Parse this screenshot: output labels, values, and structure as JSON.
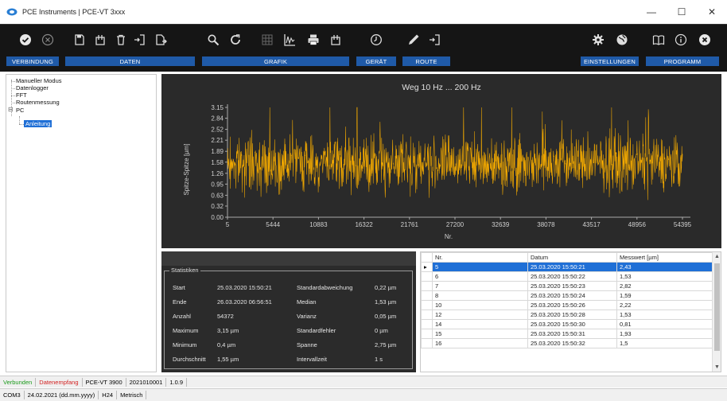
{
  "window": {
    "title": "PCE Instruments | PCE-VT 3xxx",
    "minimize": "—",
    "maximize": "☐",
    "close": "✕"
  },
  "toolbar": {
    "groups": {
      "verbindung": "VERBINDUNG",
      "daten": "DATEN",
      "grafik": "GRAFIK",
      "geraet": "GERÄT",
      "route": "ROUTE",
      "einstellungen": "EINSTELLUNGEN",
      "programm": "PROGRAMM"
    },
    "accent": "#1f5aa8"
  },
  "tree": {
    "items": [
      "Manueller Modus",
      "Datenlogger",
      "FFT",
      "Routenmessung",
      "PC",
      "Anleitung"
    ],
    "expander": "⊟"
  },
  "chart_data": {
    "type": "line",
    "title": "Weg 10 Hz ... 200 Hz",
    "xlabel": "Nr.",
    "ylabel": "Spitze-Spitze [µm]",
    "xticks": [
      "5",
      "5444",
      "10883",
      "16322",
      "21761",
      "27200",
      "32639",
      "38078",
      "43517",
      "48956",
      "54395"
    ],
    "yticks": [
      "0.00",
      "0.32",
      "0.63",
      "0.95",
      "1.26",
      "1.58",
      "1.89",
      "2.21",
      "2.52",
      "2.84",
      "3.15"
    ],
    "xlim": [
      5,
      54395
    ],
    "ylim": [
      0,
      3.15
    ],
    "series_color": "#f2a900",
    "grid": false,
    "series": [
      {
        "values_summary": {
          "min": 0.4,
          "max": 3.15,
          "mean": 1.55
        }
      }
    ]
  },
  "stats": {
    "legend": "Statistiken",
    "rows": [
      {
        "l1": "Start",
        "v1": "25.03.2020 15:50:21",
        "l2": "Standardabweichung",
        "v2": "0,22 µm"
      },
      {
        "l1": "Ende",
        "v1": "26.03.2020 06:56:51",
        "l2": "Median",
        "v2": "1,53 µm"
      },
      {
        "l1": "Anzahl",
        "v1": "54372",
        "l2": "Varianz",
        "v2": "0,05 µm"
      },
      {
        "l1": "Maximum",
        "v1": "3,15 µm",
        "l2": "Standardfehler",
        "v2": "0 µm"
      },
      {
        "l1": "Minimum",
        "v1": "0,4 µm",
        "l2": "Spanne",
        "v2": "2,75 µm"
      },
      {
        "l1": "Durchschnitt",
        "v1": "1,55 µm",
        "l2": "Intervallzeit",
        "v2": "1 s"
      }
    ]
  },
  "table": {
    "headers": [
      "Nr.",
      "Datum",
      "Messwert [µm]"
    ],
    "rows": [
      [
        "5",
        "25.03.2020 15:50:21",
        "2,43"
      ],
      [
        "6",
        "25.03.2020 15:50:22",
        "1,53"
      ],
      [
        "7",
        "25.03.2020 15:50:23",
        "2,82"
      ],
      [
        "8",
        "25.03.2020 15:50:24",
        "1,59"
      ],
      [
        "10",
        "25.03.2020 15:50:26",
        "2,22"
      ],
      [
        "12",
        "25.03.2020 15:50:28",
        "1,53"
      ],
      [
        "14",
        "25.03.2020 15:50:30",
        "0,81"
      ],
      [
        "15",
        "25.03.2020 15:50:31",
        "1,93"
      ],
      [
        "16",
        "25.03.2020 15:50:32",
        "1,5"
      ]
    ],
    "row_marker": "▸"
  },
  "status": {
    "connected": "Verbunden",
    "receiving": "Datenempfang",
    "device": "PCE-VT 3900",
    "serial": "2021010001",
    "version": "1.0.9",
    "port": "COM3",
    "date": "24.02.2021 (dd.mm.yyyy)",
    "clock": "H24",
    "units": "Metrisch"
  }
}
